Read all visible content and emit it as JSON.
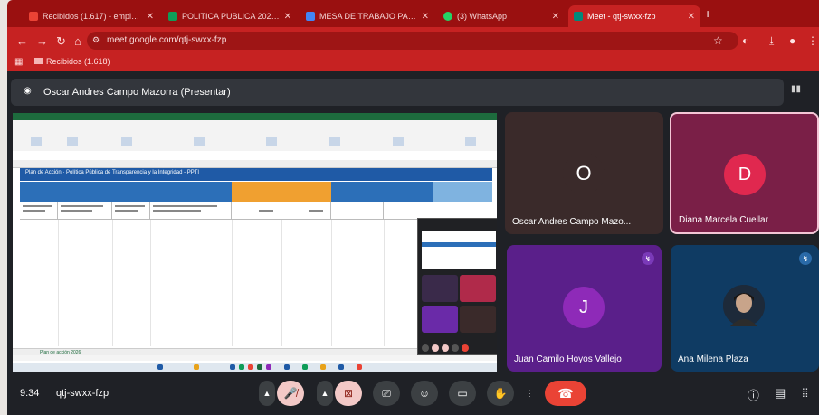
{
  "browser": {
    "tabs": [
      {
        "label": "Recibidos (1.617) - emplea...",
        "color": "#ea4335"
      },
      {
        "label": "POLITICA PUBLICA 2026 - C...",
        "color": "#0f9d58"
      },
      {
        "label": "MESA DE TRABAJO PARA L...",
        "color": "#4285f4"
      },
      {
        "label": "(3) WhatsApp",
        "color": "#25d366"
      },
      {
        "label": "Meet - qtj-swxx-fzp",
        "color": "#00897b",
        "active": true
      }
    ],
    "url": "meet.google.com/qtj-swxx-fzp",
    "bookmark": "Recibidos (1.618)"
  },
  "meet": {
    "presenter_label": "Oscar Andres Campo Mazorra (Presentar)",
    "spreadsheet": {
      "title": "Plan de Acción · Política Pública de Transparencia y la Integridad - PPTI",
      "sheet_tab": "Plan de acción 2026"
    },
    "participants": [
      {
        "name": "Oscar Andres Campo Mazo...",
        "initial": "O",
        "bg": "#3a2a2a",
        "avatar_bg": "#3a2a2a"
      },
      {
        "name": "Diana Marcela Cuellar",
        "initial": "D",
        "bg": "#7a1f47",
        "avatar_bg": "#e0284f"
      },
      {
        "name": "Juan Camilo Hoyos Vallejo",
        "initial": "J",
        "bg": "#5a1f8a",
        "avatar_bg": "#8e2ab8"
      },
      {
        "name": "Ana Milena Plaza",
        "initial": "",
        "bg": "#0f3b63",
        "avatar_bg": "#1d2a3a"
      }
    ],
    "time": "9:34",
    "meeting_code": "qtj-swxx-fzp"
  }
}
